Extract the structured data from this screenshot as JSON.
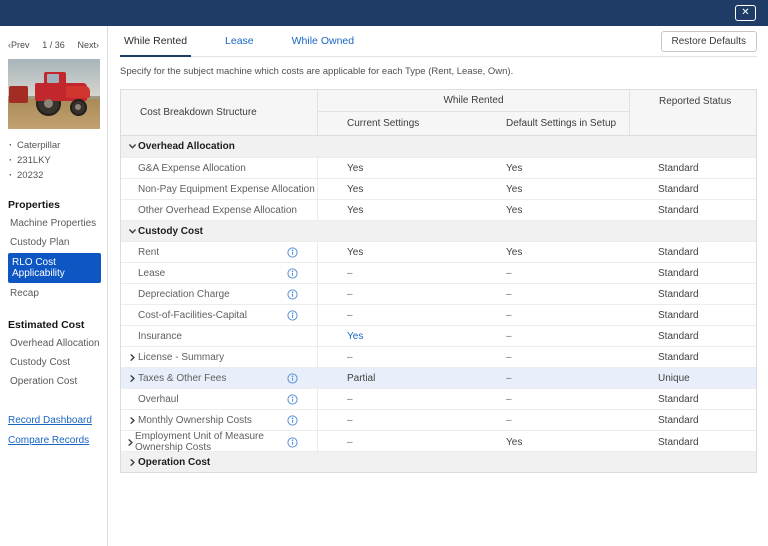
{
  "colors": {
    "topbar": "#1f3c66",
    "accent": "#1a66c2",
    "selected_nav": "#0e56c3",
    "highlight_row": "#e8effa",
    "info_icon": "#5b91d8"
  },
  "icons": {
    "close": "✕",
    "chevron_down": "v",
    "chevron_right": ">",
    "info": "i"
  },
  "sidebar": {
    "pagination": {
      "prev": "‹Prev",
      "page": "1 / 36",
      "next": "Next›"
    },
    "machine": {
      "bullets": [
        "Caterpillar",
        "231LKY",
        "20232"
      ]
    },
    "sections": [
      {
        "heading": "Properties",
        "items": [
          {
            "label": "Machine Properties",
            "selected": false
          },
          {
            "label": "Custody Plan",
            "selected": false
          },
          {
            "label": "RLO Cost Applicability",
            "selected": true
          },
          {
            "label": "Recap",
            "selected": false
          }
        ]
      },
      {
        "heading": "Estimated Cost",
        "items": [
          {
            "label": "Overhead Allocation",
            "selected": false
          },
          {
            "label": "Custody Cost",
            "selected": false
          },
          {
            "label": "Operation Cost",
            "selected": false
          }
        ]
      }
    ],
    "links": [
      "Record Dashboard",
      "Compare Records"
    ]
  },
  "main": {
    "tabs": [
      {
        "label": "While Rented",
        "active": true
      },
      {
        "label": "Lease",
        "active": false
      },
      {
        "label": "While Owned",
        "active": false
      }
    ],
    "restore_button": "Restore Defaults",
    "description": "Specify for the subject machine which costs are applicable for each Type (Rent, Lease, Own).",
    "table": {
      "header": {
        "name_col": "Cost Breakdown Structure",
        "group_col": "While Rented",
        "sub_col1": "Current Settings",
        "sub_col2": "Default Settings in Setup",
        "status_col": "Reported Status"
      },
      "rows": [
        {
          "type": "group",
          "label": "Overhead Allocation",
          "state": "expanded"
        },
        {
          "type": "item",
          "label": "G&A Expense Allocation",
          "expandable": false,
          "info": false,
          "current": "Yes",
          "default": "Yes",
          "status": "Standard",
          "highlight": false,
          "current_modified": false
        },
        {
          "type": "item",
          "label": "Non-Pay Equipment Expense Allocation",
          "expandable": false,
          "info": false,
          "current": "Yes",
          "default": "Yes",
          "status": "Standard",
          "highlight": false,
          "current_modified": false
        },
        {
          "type": "item",
          "label": "Other Overhead Expense Allocation",
          "expandable": false,
          "info": false,
          "current": "Yes",
          "default": "Yes",
          "status": "Standard",
          "highlight": false,
          "current_modified": false
        },
        {
          "type": "group",
          "label": "Custody Cost",
          "state": "expanded"
        },
        {
          "type": "item",
          "label": "Rent",
          "expandable": false,
          "info": true,
          "current": "Yes",
          "default": "Yes",
          "status": "Standard",
          "highlight": false,
          "current_modified": false
        },
        {
          "type": "item",
          "label": "Lease",
          "expandable": false,
          "info": true,
          "current": "–",
          "default": "–",
          "status": "Standard",
          "highlight": false,
          "current_modified": false
        },
        {
          "type": "item",
          "label": "Depreciation Charge",
          "expandable": false,
          "info": true,
          "current": "–",
          "default": "–",
          "status": "Standard",
          "highlight": false,
          "current_modified": false
        },
        {
          "type": "item",
          "label": "Cost-of-Facilities-Capital",
          "expandable": false,
          "info": true,
          "current": "–",
          "default": "–",
          "status": "Standard",
          "highlight": false,
          "current_modified": false
        },
        {
          "type": "item",
          "label": "Insurance",
          "expandable": false,
          "info": false,
          "current": "Yes",
          "default": "–",
          "status": "Standard",
          "highlight": false,
          "current_modified": true
        },
        {
          "type": "item",
          "label": "License - Summary",
          "expandable": true,
          "info": false,
          "current": "–",
          "default": "–",
          "status": "Standard",
          "highlight": false,
          "current_modified": false
        },
        {
          "type": "item",
          "label": "Taxes & Other Fees",
          "expandable": true,
          "info": true,
          "current": "Partial",
          "default": "–",
          "status": "Unique",
          "highlight": true,
          "current_modified": false
        },
        {
          "type": "item",
          "label": "Overhaul",
          "expandable": false,
          "info": true,
          "current": "–",
          "default": "–",
          "status": "Standard",
          "highlight": false,
          "current_modified": false
        },
        {
          "type": "item",
          "label": "Monthly Ownership Costs",
          "expandable": true,
          "info": true,
          "current": "–",
          "default": "–",
          "status": "Standard",
          "highlight": false,
          "current_modified": false
        },
        {
          "type": "item",
          "label": "Employment Unit of Measure Ownership Costs",
          "expandable": true,
          "info": true,
          "current": "–",
          "default": "Yes",
          "status": "Standard",
          "highlight": false,
          "current_modified": false
        },
        {
          "type": "group",
          "label": "Operation Cost",
          "state": "collapsed"
        }
      ]
    }
  }
}
